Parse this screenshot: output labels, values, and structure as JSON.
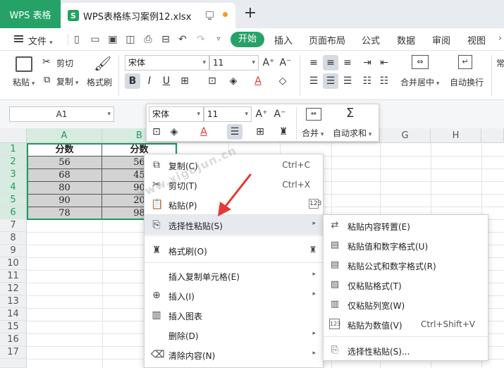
{
  "tabs": {
    "app": "WPS 表格",
    "doc": "WPS表格练习案例12.xlsx",
    "doc_icon": "S"
  },
  "menubar": {
    "file": "文件",
    "items": [
      "开始",
      "插入",
      "页面布局",
      "公式",
      "数据",
      "审阅",
      "视图"
    ]
  },
  "ribbon": {
    "paste": "粘贴",
    "cut": "剪切",
    "copy": "复制",
    "format_painter": "格式刷",
    "font": "宋体",
    "size": "11",
    "merge": "合并居中",
    "wrap": "自动换行",
    "extra": "常"
  },
  "namebox": "A1",
  "mini_toolbar": {
    "font": "宋体",
    "size": "11",
    "merge": "合并",
    "autosum": "自动求和"
  },
  "grid": {
    "columns": [
      "A",
      "B",
      "C",
      "D",
      "E",
      "F",
      "G",
      "H"
    ],
    "rows": [
      "1",
      "2",
      "3",
      "4",
      "5",
      "6",
      "7",
      "8",
      "9",
      "10",
      "11",
      "12",
      "13",
      "14",
      "15",
      "16",
      "17"
    ],
    "header_cells": [
      "分数",
      "分数"
    ],
    "col_a": [
      "56",
      "68",
      "80",
      "90",
      "78"
    ],
    "col_b": [
      "56",
      "45",
      "90",
      "20",
      "98"
    ]
  },
  "context_menu": [
    {
      "label": "复制(C)",
      "shortcut": "Ctrl+C"
    },
    {
      "label": "剪切(T)",
      "shortcut": "Ctrl+X"
    },
    {
      "label": "粘贴(P)"
    },
    {
      "label": "选择性粘贴(S)"
    },
    {
      "label": "格式刷(O)"
    },
    {
      "label": "插入复制单元格(E)"
    },
    {
      "label": "插入(I)"
    },
    {
      "label": "插入图表"
    },
    {
      "label": "删除(D)"
    },
    {
      "label": "清除内容(N)"
    }
  ],
  "submenu": [
    {
      "label": "粘贴内容转置(E)"
    },
    {
      "label": "粘贴值和数字格式(U)"
    },
    {
      "label": "粘贴公式和数字格式(R)"
    },
    {
      "label": "仅粘贴格式(T)"
    },
    {
      "label": "仅粘贴列宽(W)"
    },
    {
      "label": "粘贴为数值(V)",
      "shortcut": "Ctrl+Shift+V"
    },
    {
      "label": "选择性粘贴(S)..."
    }
  ],
  "watermark": "www.xigujun.cn",
  "colors": {
    "accent": "#26a268",
    "selection": "#1e9b5c",
    "arrow": "#e53935"
  }
}
